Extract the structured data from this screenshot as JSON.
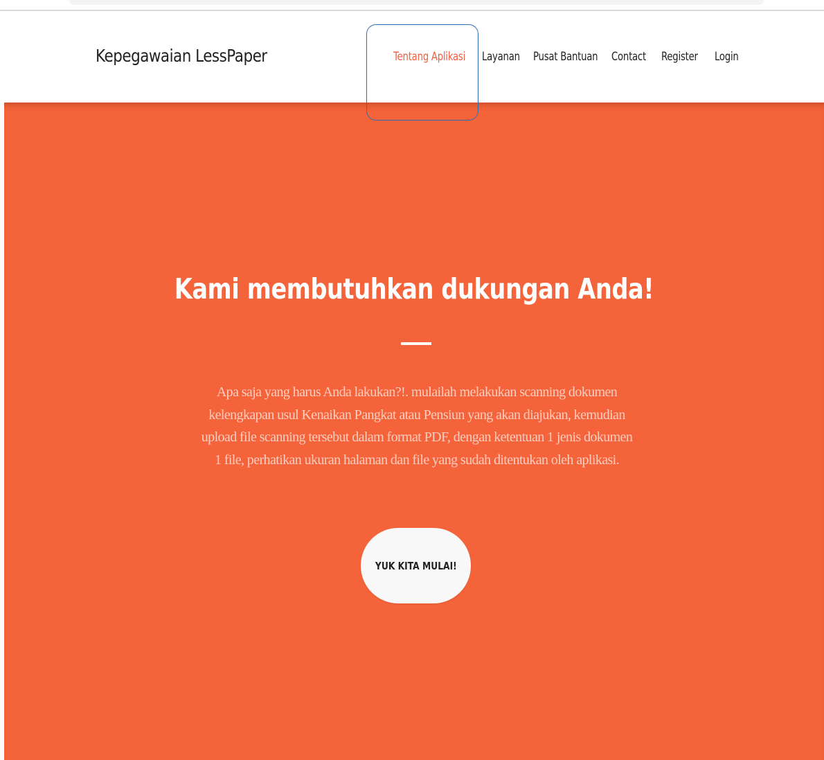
{
  "navbar": {
    "brand": "Kepegawaian LessPaper",
    "items": [
      {
        "label": "Tentang Aplikasi",
        "active": true
      },
      {
        "label": "Layanan",
        "active": false
      },
      {
        "label": "Pusat Bantuan",
        "active": false
      },
      {
        "label": "Contact",
        "active": false
      },
      {
        "label": "Register",
        "active": false
      },
      {
        "label": "Login",
        "active": false
      }
    ]
  },
  "hero": {
    "title": "Kami membutuhkan dukungan Anda!",
    "text": "Apa saja yang harus Anda lakukan?!. mulailah melakukan scanning dokumen kelengkapan usul Kenaikan Pangkat atau Pensiun yang akan diajukan, kemudian upload file scanning tersebut dalam format PDF, dengan ketentuan 1 jenis dokumen 1 file, perhatikan ukuran halaman dan file yang sudah ditentukan oleh aplikasi.",
    "cta_label": "YUK KITA MULAI!"
  },
  "colors": {
    "accent": "#f05f40",
    "hero_bg": "#f4633a",
    "focus_ring": "#2f6eb5"
  }
}
